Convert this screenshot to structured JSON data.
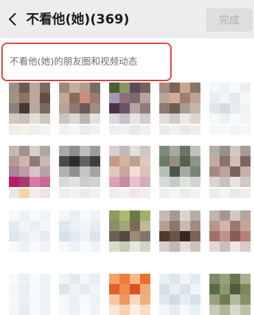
{
  "header": {
    "back_icon": "chevron-left-icon",
    "title": "不看他(她)(369)",
    "done_label": "完成"
  },
  "description": {
    "text": "不看他(她)的朋友圈和视频动态"
  },
  "contacts": {
    "note": "",
    "avatars": [
      [
        "#9b8f86",
        "#6d5a4e",
        "#b8a79a",
        "#7c6c62",
        "#a39184",
        "#8e7464",
        "#c0a596",
        "#5f4f47",
        "#8a8279",
        "#433a36",
        "#b9aaa0",
        "#7b6a61",
        "#d1c8c2",
        "#c9c0b8",
        "#e3ddd8",
        "#cfc5bd"
      ],
      [
        "#9a8a7e",
        "#c0ae9f",
        "#b49c8c",
        "#7d6b61",
        "#c4a89a",
        "#8b6a5c",
        "#d08a7a",
        "#9a7b70",
        "#b7a296",
        "#8d7a71",
        "#6c5b55",
        "#a08c82",
        "#cbc4bf",
        "#dfd8d3",
        "#bdb5b0",
        "#e6e1dd"
      ],
      [
        "#4e5c3a",
        "#8a9660",
        "#5d4a5c",
        "#76625a",
        "#a29ab2",
        "#8d6f7c",
        "#7d6a6a",
        "#b8a3a0",
        "#4a3245",
        "#6a5267",
        "#b2a4a6",
        "#8f7b79",
        "#dcd7dc",
        "#c7bfc5",
        "#e8e3e6",
        "#d2cbcf"
      ],
      [
        "#a28c7e",
        "#7a6456",
        "#c9a391",
        "#8c7366",
        "#b8a69a",
        "#d4ac98",
        "#9e7f70",
        "#c0a494",
        "#8a7a70",
        "#6f5c52",
        "#a99b93",
        "#c4b6ad",
        "#e2dcd8",
        "#d2cac4",
        "#ece8e5",
        "#dcd5d0"
      ],
      [
        "#f4f6f7",
        "#eef1f3",
        "#f7f8f9",
        "#eceff1",
        "#e9edf0",
        "#f1f3f5",
        "#e3e8eb",
        "#f5f7f8",
        "#dfe7ea",
        "#d2dde3",
        "#e6ecef",
        "#f0f3f5",
        "#f6f8f9",
        "#eef1f3",
        "#f8f9fa",
        "#f2f4f6"
      ],
      [
        "#c3b8b2",
        "#9f938d",
        "#d6cfcb",
        "#b0a59f",
        "#b49a94",
        "#d2b5ac",
        "#8e7a76",
        "#c8b9b3",
        "#a98495",
        "#c09aa9",
        "#d7c4c9",
        "#b7a2a9",
        "#b91d6a",
        "#a53c6e",
        "#d67aa2",
        "#c86a94"
      ],
      [
        "#a9a9a9",
        "#8f8f8f",
        "#bdbdbd",
        "#9c9c9c",
        "#4a4a4a",
        "#2c2c2c",
        "#616161",
        "#3d3d3d",
        "#b0b0b0",
        "#8e8e8e",
        "#c4c4c4",
        "#a3a3a3",
        "#d9d9d9",
        "#e3e3e3",
        "#cdcdcd",
        "#d3d3d3"
      ],
      [
        "#d6d1cf",
        "#c2bab6",
        "#e4dfdd",
        "#cec8c5",
        "#c69a86",
        "#d6b2a3",
        "#b9a194",
        "#e0c9be",
        "#e3c7be",
        "#c9a79c",
        "#f2dfd9",
        "#dcc0b8",
        "#dea2b8",
        "#c98aa3",
        "#e8bfd0",
        "#d7aabd"
      ],
      [
        "#7f8a7c",
        "#a5ab9e",
        "#6c7467",
        "#bfc4bb",
        "#6d7b66",
        "#9a8e84",
        "#57614f",
        "#8b968a",
        "#b7bfb6",
        "#4d5749",
        "#a1ab9f",
        "#7a8476",
        "#d6dbd7",
        "#c5ccc7",
        "#e0e4e1",
        "#cfd5d1"
      ],
      [
        "#b5ada8",
        "#9a908a",
        "#cfc8c3",
        "#a79d97",
        "#c8a9a0",
        "#8d7068",
        "#d2bdb5",
        "#7c6660",
        "#a58980",
        "#bea39a",
        "#7a625b",
        "#c6b0a8",
        "#dcd4d0",
        "#c9c0bb",
        "#e7e1de",
        "#d1c8c3"
      ],
      [
        "#f5f7f9",
        "#eaf0f5",
        "#f8f9fb",
        "#eef3f7",
        "#e4ecf2",
        "#f1f5f8",
        "#e9eff4",
        "#f4f7fa",
        "#dde6ee",
        "#e8eef3",
        "#f2f5f8",
        "#e6ecf1",
        "#f7f9fb",
        "#eef2f6",
        "#f9fafc",
        "#f1f4f7"
      ],
      [
        "#f3f6f8",
        "#e8eef2",
        "#f7f9fa",
        "#edf2f5",
        "#dee8ee",
        "#eaf0f4",
        "#f2f6f8",
        "#e5edf2",
        "#d6e2ea",
        "#e1eaf0",
        "#ecf2f5",
        "#dbe6ec",
        "#f5f8fa",
        "#ebf1f4",
        "#f8fafb",
        "#eff4f6"
      ],
      [
        "#8e9b5a",
        "#b0b96e",
        "#6d7a45",
        "#a3ad68",
        "#8b8e67",
        "#a5a37a",
        "#7a6b58",
        "#c1b992",
        "#6e5f55",
        "#57473e",
        "#9c8a79",
        "#84746a",
        "#d8dcc9",
        "#c6ccb2",
        "#e5e8d9",
        "#d0d5c0"
      ],
      [
        "#c7bbb4",
        "#a89a92",
        "#dcd2cc",
        "#b9aca5",
        "#b59f95",
        "#8f7569",
        "#cbb7ad",
        "#a28b80",
        "#4f3a33",
        "#6b534a",
        "#382821",
        "#7d6458",
        "#d6cdc8",
        "#c4b8b2",
        "#e3dcd8",
        "#cdc3bd"
      ],
      [
        "#c2b3ad",
        "#a7968f",
        "#d4c8c3",
        "#b5a59f",
        "#b8948b",
        "#d3b4ab",
        "#9d7a70",
        "#c7a59b",
        "#a46f6a",
        "#c29089",
        "#8a5c57",
        "#b88079",
        "#e1d7d3",
        "#ccbfba",
        "#ebe4e1",
        "#d6cbc6"
      ],
      [
        "#f6f8f9",
        "#edf1f3",
        "#f9fafb",
        "#f0f3f5",
        "#f3f5f7",
        "#e9eef1",
        "#f7f9fa",
        "#eef2f4",
        "#f5f7f9",
        "#ebf0f3",
        "#f8f9fa",
        "#eff2f4",
        "#f4f6f8",
        "#e8edf0",
        "#f9fafb",
        "#f0f3f5"
      ],
      [
        "#eef3f6",
        "#e2ebf0",
        "#f4f7f9",
        "#e8eff3",
        "#dbe6ec",
        "#eef3f6",
        "#e4ecf1",
        "#f0f5f8",
        "#f5f8fa",
        "#e9f0f4",
        "#f8fafb",
        "#edf2f6",
        "#f6f9fa",
        "#ebf1f5",
        "#f9fbfc",
        "#eff4f7"
      ],
      [
        "#f3a06b",
        "#ea7d3e",
        "#f7b98c",
        "#e86f2f",
        "#e0602a",
        "#f08a4f",
        "#d9541f",
        "#f5a877",
        "#f6c7a6",
        "#eb9a63",
        "#fad8bf",
        "#f0ae81",
        "#fbe4d3",
        "#f7d0b4",
        "#fdeee3",
        "#f9dcc6"
      ],
      [
        "#eaeff3",
        "#dde6ec",
        "#f1f5f8",
        "#e3eaef",
        "#d4dfe6",
        "#e8eef2",
        "#dae3e9",
        "#eef3f6",
        "#e0e8ed",
        "#d0dbe3",
        "#e7edf1",
        "#d7e1e7",
        "#f2f6f8",
        "#e6ecf0",
        "#f6f9fa",
        "#ebf0f3"
      ],
      [
        "#7d8a66",
        "#96a07c",
        "#6a7554",
        "#a8b08f",
        "#5a6a45",
        "#8b986b",
        "#4f5c3d",
        "#7a8a5a",
        "#9aa07e",
        "#6f7c56",
        "#b3b99c",
        "#85916a",
        "#c6cbb4",
        "#aeb696",
        "#d6dac8",
        "#bcc2a8"
      ]
    ],
    "captions": [
      [
        "#ecedea",
        "#f6f1e9",
        "#eeeeec",
        "#f3f3f1"
      ],
      [
        "#f0f0f0",
        "#f5f5f5",
        "#ececec",
        "#f2f2f2"
      ],
      [
        "#f0eded",
        "#f4f0f1",
        "#ebe8ea",
        "#f2eff0"
      ],
      [
        "#eeeae8",
        "#f4f1ef",
        "#ebe7e4",
        "#f1edea"
      ],
      [
        "#f4f6f7",
        "#f7f8f9",
        "#f2f4f5",
        "#f6f7f8"
      ],
      [
        "#ece7e5",
        "#f5d7a4",
        "#f3eee9",
        "#ebe6e3"
      ],
      [
        "#eeeeee",
        "#f3f3f3",
        "#ebebeb",
        "#f1f1f1"
      ],
      [
        "#f0ecea",
        "#f6f1ef",
        "#ede8e6",
        "#f3eeec"
      ],
      [
        "#eef0ee",
        "#f3f5f3",
        "#ebedeb",
        "#f1f3f1"
      ],
      [
        "#efebe9",
        "#f5f2f0",
        "#ece8e6",
        "#f2eeec"
      ]
    ]
  }
}
